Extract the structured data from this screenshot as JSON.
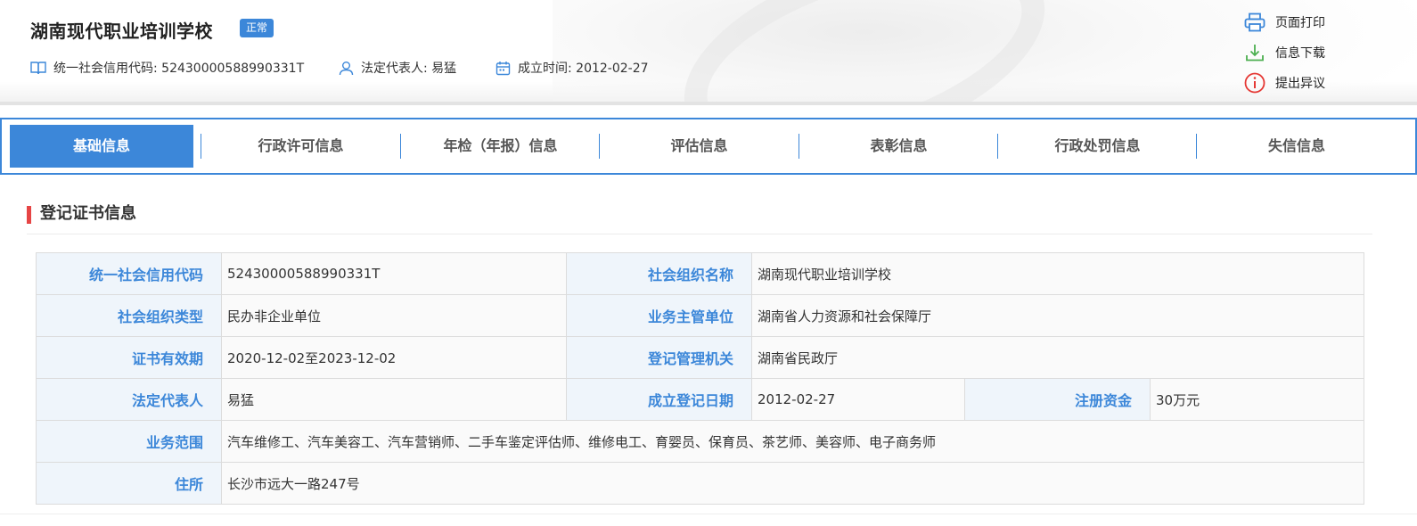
{
  "header": {
    "title": "湖南现代职业培训学校",
    "status": "正常",
    "meta": [
      {
        "icon": "book-icon",
        "text": "统一社会信用代码: 52430000588990331T"
      },
      {
        "icon": "user-icon",
        "text": "法定代表人: 易猛"
      },
      {
        "icon": "calendar-icon",
        "text": "成立时间: 2012-02-27"
      }
    ]
  },
  "actions": [
    {
      "icon": "printer-icon",
      "label": "页面打印"
    },
    {
      "icon": "download-icon",
      "label": "信息下载"
    },
    {
      "icon": "info-circle-icon",
      "label": "提出异议"
    }
  ],
  "tabs": [
    {
      "label": "基础信息",
      "active": true
    },
    {
      "label": "行政许可信息"
    },
    {
      "label": "年检（年报）信息"
    },
    {
      "label": "评估信息"
    },
    {
      "label": "表彰信息"
    },
    {
      "label": "行政处罚信息"
    },
    {
      "label": "失信信息"
    }
  ],
  "section": {
    "title": "登记证书信息"
  },
  "table": {
    "credit_code_label": "统一社会信用代码",
    "credit_code": "52430000588990331T",
    "org_name_label": "社会组织名称",
    "org_name": "湖南现代职业培训学校",
    "org_type_label": "社会组织类型",
    "org_type": "民办非企业单位",
    "authority_label": "业务主管单位",
    "authority": "湖南省人力资源和社会保障厅",
    "validity_label": "证书有效期",
    "validity": "2020-12-02至2023-12-02",
    "registrar_label": "登记管理机关",
    "registrar": "湖南省民政厅",
    "legal_rep_label": "法定代表人",
    "legal_rep": "易猛",
    "reg_date_label": "成立登记日期",
    "reg_date": "2012-02-27",
    "capital_label": "注册资金",
    "capital": "30万元",
    "scope_label": "业务范围",
    "scope": "汽车维修工、汽车美容工、汽车营销师、二手车鉴定评估师、维修电工、育婴员、保育员、茶艺师、美容师、电子商务师",
    "address_label": "住所",
    "address": "长沙市远大一路247号"
  },
  "colors": {
    "accent": "#3c87d9",
    "label_bg": "#eff5fb",
    "section_mark": "#e64545",
    "download_green": "#4caf50",
    "alert_red": "#e53935"
  }
}
